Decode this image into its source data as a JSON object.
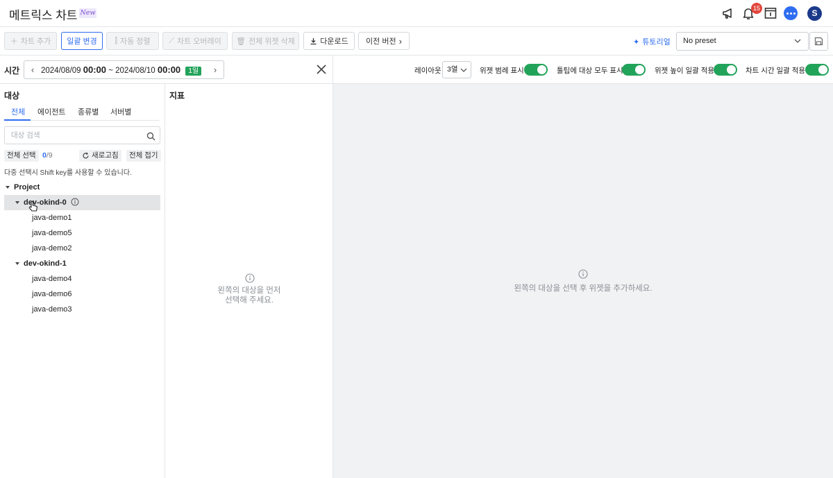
{
  "header": {
    "title": "메트릭스 차트",
    "badge": "New",
    "notification_count": "15",
    "avatar_initial": "S"
  },
  "toolbar": {
    "add_chart": "차트 추가",
    "bulk_edit": "일괄 변경",
    "auto_arrange": "자동 정렬",
    "chart_overlay": "차트 오버레이",
    "delete_all_widgets": "전체 위젯 삭제",
    "download": "다운로드",
    "previous_version": "이전 버전",
    "tutorial": "튜토리얼",
    "preset_value": "No preset"
  },
  "time": {
    "label": "시간",
    "start_date": "2024/08/09",
    "start_time": "00:00",
    "separator": "~",
    "end_date": "2024/08/10",
    "end_time": "00:00",
    "duration": "1일"
  },
  "target": {
    "title": "대상",
    "tabs": [
      "전체",
      "에이전트",
      "종류별",
      "서버별"
    ],
    "search_placeholder": "대상 검색",
    "select_all": "전체 선택",
    "selected": "0",
    "total": "/9",
    "refresh": "새로고침",
    "collapse_all": "전체 접기",
    "hint": "다중 선택시 Shift key를 사용할 수 있습니다.",
    "tree": {
      "root": "Project",
      "groups": [
        {
          "name": "dev-okind-0",
          "children": [
            "java-demo1",
            "java-demo5",
            "java-demo2"
          ]
        },
        {
          "name": "dev-okind-1",
          "children": [
            "java-demo4",
            "java-demo6",
            "java-demo3"
          ]
        }
      ]
    }
  },
  "metric": {
    "title": "지표",
    "empty_line1": "왼쪽의 대상을 먼저",
    "empty_line2": "선택해 주세요."
  },
  "options": {
    "layout_label": "레이아웃",
    "layout_value": "3열",
    "show_widget_legend": "위젯 범례 표시",
    "tooltip_show_all": "툴팁에 대상 모두 표시",
    "widget_height_bulk": "위젯 높이 일괄 적용",
    "chart_time_bulk": "차트 시간 일괄 적용"
  },
  "canvas": {
    "empty_message": "왼쪽의 대상을 선택 후 위젯을 추가하세요."
  },
  "colors": {
    "accent": "#2f6df0",
    "toggle_on": "#22a35a",
    "badge_red": "#e2453c"
  }
}
